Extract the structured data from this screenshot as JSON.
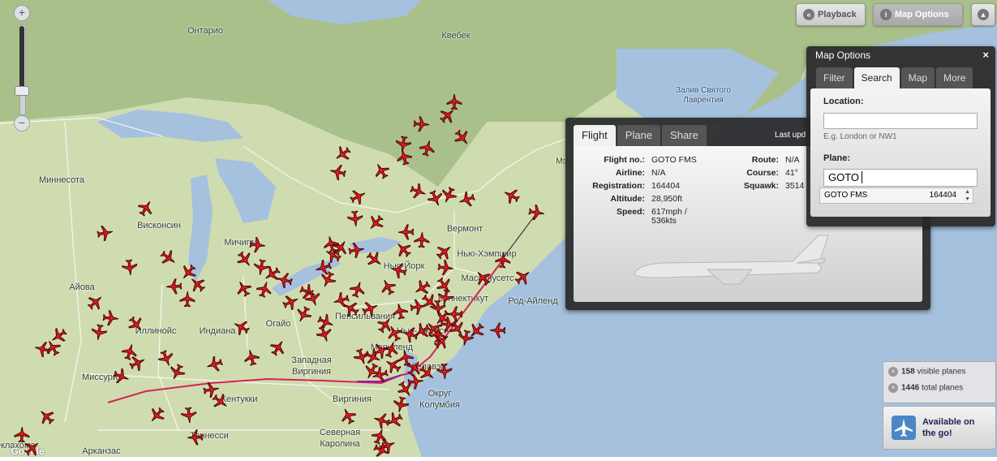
{
  "map": {
    "labels": {
      "ontario": "Онтарио",
      "quebec": "Квебек",
      "minnesota": "Миннесота",
      "wisconsin": "Висконсин",
      "michigan": "Мичиган",
      "iowa": "Айова",
      "illinois": "Иллинойс",
      "indiana": "Индиана",
      "ohio": "Огайо",
      "missouri": "Миссури",
      "kentucky": "Кентукки",
      "west_virginia_1": "Западная",
      "west_virginia_2": "Виргиния",
      "virginia": "Виргиния",
      "pennsylvania": "Пенсильвания",
      "new_york": "Нью-Йорк",
      "vermont": "Вермонт",
      "new_hampshire": "Нью-Хэмпшир",
      "massachusetts": "Массачусетс",
      "connecticut": "Коннектикут",
      "rhode_island": "Род-Айленд",
      "new_jersey": "Нью-Джерси",
      "maryland": "Мэриленд",
      "delaware": "Делавэр",
      "dc_1": "Округ",
      "dc_2": "Колумбия",
      "tennessee": "Теннесси",
      "north_carolina_1": "Северная",
      "north_carolina_2": "Каролина",
      "arkansas": "Арканзас",
      "oklahoma": "Оклахома",
      "gulf_1": "Залив Святого",
      "gulf_2": "Лаврентия",
      "maine_partial": "Мэ",
      "nh_partial": "Нь"
    },
    "google_logo": "Google",
    "colors": {
      "land": "#cfdcb0",
      "forest": "#a9c08a",
      "water": "#a5c1de",
      "plane": "#e11b1b",
      "track": "#d2235a"
    }
  },
  "zoom": {
    "in_label": "+",
    "out_label": "−"
  },
  "toolbar": {
    "playback_label": "Playback",
    "map_options_label": "Map Options",
    "playback_icon": "rewind-icon",
    "map_options_icon": "info-icon",
    "collapse_icon": "eject-icon"
  },
  "flight_panel": {
    "tabs": [
      "Flight",
      "Plane",
      "Share"
    ],
    "last_updated": "Last upd",
    "fields": {
      "flight_no": {
        "label": "Flight no.:",
        "value": "GOTO FMS"
      },
      "airline": {
        "label": "Airline:",
        "value": "N/A"
      },
      "registration": {
        "label": "Registration:",
        "value": "164404"
      },
      "altitude": {
        "label": "Altitude:",
        "value": "28,950ft"
      },
      "speed": {
        "label": "Speed:",
        "value": "617mph /",
        "value2": "536kts"
      },
      "route": {
        "label": "Route:",
        "value": "N/A"
      },
      "course": {
        "label": "Course:",
        "value": "41°"
      },
      "squawk": {
        "label": "Squawk:",
        "value": "3514"
      }
    }
  },
  "map_options": {
    "title": "Map Options",
    "close": "×",
    "tabs": [
      "Filter",
      "Search",
      "Map",
      "More"
    ],
    "location_label": "Location:",
    "location_value": "",
    "location_hint": "E.g. London or NW1",
    "plane_label": "Plane:",
    "plane_value": "GOTO",
    "suggestion": {
      "callsign": "GOTO FMS",
      "registration": "164404"
    }
  },
  "counters": {
    "visible_count": "158",
    "visible_text": "visible planes",
    "total_count": "1446",
    "total_text": "total planes"
  },
  "app_promo": {
    "line1": "Available on",
    "line2": "the go!"
  }
}
